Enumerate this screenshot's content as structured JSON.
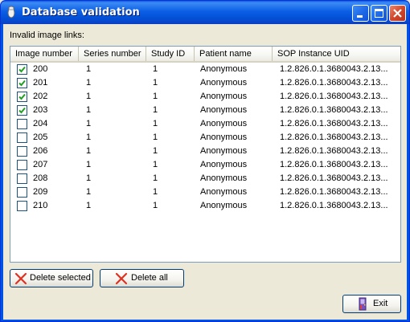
{
  "window": {
    "title": "Database validation",
    "controls": [
      "minimize",
      "maximize",
      "close"
    ]
  },
  "section_label": "Invalid image links:",
  "table": {
    "columns": [
      "Image number",
      "Series number",
      "Study ID",
      "Patient name",
      "SOP Instance UID"
    ],
    "rows": [
      {
        "checked": true,
        "image_number": "200",
        "series_number": "1",
        "study_id": "1",
        "patient_name": "Anonymous",
        "sop_uid": "1.2.826.0.1.3680043.2.13..."
      },
      {
        "checked": true,
        "image_number": "201",
        "series_number": "1",
        "study_id": "1",
        "patient_name": "Anonymous",
        "sop_uid": "1.2.826.0.1.3680043.2.13..."
      },
      {
        "checked": true,
        "image_number": "202",
        "series_number": "1",
        "study_id": "1",
        "patient_name": "Anonymous",
        "sop_uid": "1.2.826.0.1.3680043.2.13..."
      },
      {
        "checked": true,
        "image_number": "203",
        "series_number": "1",
        "study_id": "1",
        "patient_name": "Anonymous",
        "sop_uid": "1.2.826.0.1.3680043.2.13..."
      },
      {
        "checked": false,
        "image_number": "204",
        "series_number": "1",
        "study_id": "1",
        "patient_name": "Anonymous",
        "sop_uid": "1.2.826.0.1.3680043.2.13..."
      },
      {
        "checked": false,
        "image_number": "205",
        "series_number": "1",
        "study_id": "1",
        "patient_name": "Anonymous",
        "sop_uid": "1.2.826.0.1.3680043.2.13..."
      },
      {
        "checked": false,
        "image_number": "206",
        "series_number": "1",
        "study_id": "1",
        "patient_name": "Anonymous",
        "sop_uid": "1.2.826.0.1.3680043.2.13..."
      },
      {
        "checked": false,
        "image_number": "207",
        "series_number": "1",
        "study_id": "1",
        "patient_name": "Anonymous",
        "sop_uid": "1.2.826.0.1.3680043.2.13..."
      },
      {
        "checked": false,
        "image_number": "208",
        "series_number": "1",
        "study_id": "1",
        "patient_name": "Anonymous",
        "sop_uid": "1.2.826.0.1.3680043.2.13..."
      },
      {
        "checked": false,
        "image_number": "209",
        "series_number": "1",
        "study_id": "1",
        "patient_name": "Anonymous",
        "sop_uid": "1.2.826.0.1.3680043.2.13..."
      },
      {
        "checked": false,
        "image_number": "210",
        "series_number": "1",
        "study_id": "1",
        "patient_name": "Anonymous",
        "sop_uid": "1.2.826.0.1.3680043.2.13..."
      }
    ]
  },
  "buttons": {
    "delete_selected": {
      "label": "Delete selected",
      "icon": "red-x-icon"
    },
    "delete_all": {
      "label": "Delete all",
      "icon": "red-x-icon"
    },
    "exit": {
      "label": "Exit",
      "icon": "exit-door-icon"
    }
  },
  "colors": {
    "titlebar": "#0054e3",
    "face": "#ece9d8",
    "check": "#21a121",
    "delete_icon": "#e03020"
  }
}
